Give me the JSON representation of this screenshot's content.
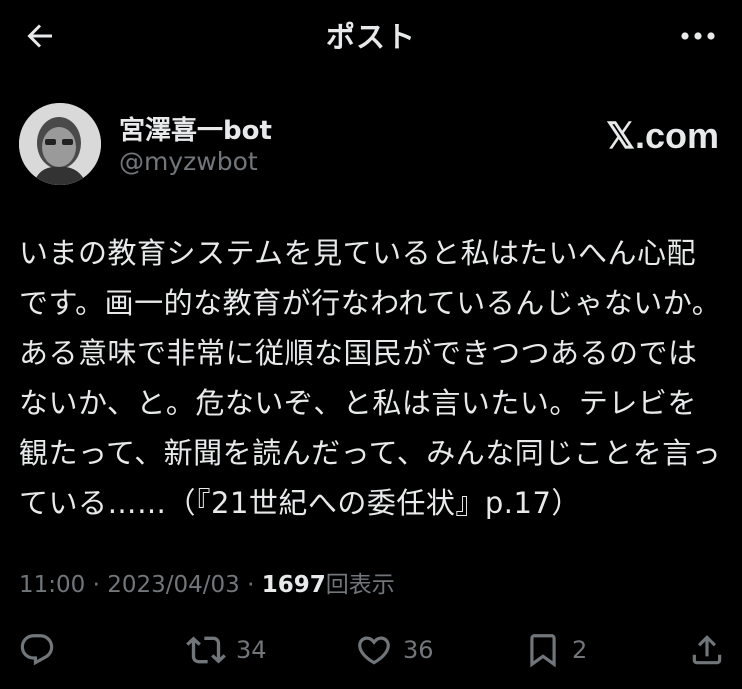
{
  "header": {
    "title": "ポスト",
    "back_icon": "arrow-left-icon",
    "more_icon": "more-horizontal-icon"
  },
  "author": {
    "display_name": "宮澤喜一bot",
    "handle": "@myzwbot",
    "source_badge": "𝕏.com"
  },
  "post": {
    "text": "いまの教育システムを見ていると私はたいへん心配です。画一的な教育が行なわれているんじゃないか。ある意味で非常に従順な国民ができつつあるのではないか、と。危ないぞ、と私は言いたい。テレビを観たって、新聞を読んだって、みんな同じことを言っている……（『21世紀への委任状』p.17）"
  },
  "meta": {
    "time": "11:00",
    "separator1": " · ",
    "date": "2023/04/03",
    "separator2": " · ",
    "views_count": "1697",
    "views_label": "回表示"
  },
  "actions": {
    "reply": {
      "icon": "reply-icon",
      "count": ""
    },
    "repost": {
      "icon": "repost-icon",
      "count": "34"
    },
    "like": {
      "icon": "heart-icon",
      "count": "36"
    },
    "bookmark": {
      "icon": "bookmark-icon",
      "count": "2"
    },
    "share": {
      "icon": "share-icon",
      "count": ""
    }
  },
  "colors": {
    "background": "#000000",
    "primary_text": "#e7e9ea",
    "secondary_text": "#71767b"
  }
}
